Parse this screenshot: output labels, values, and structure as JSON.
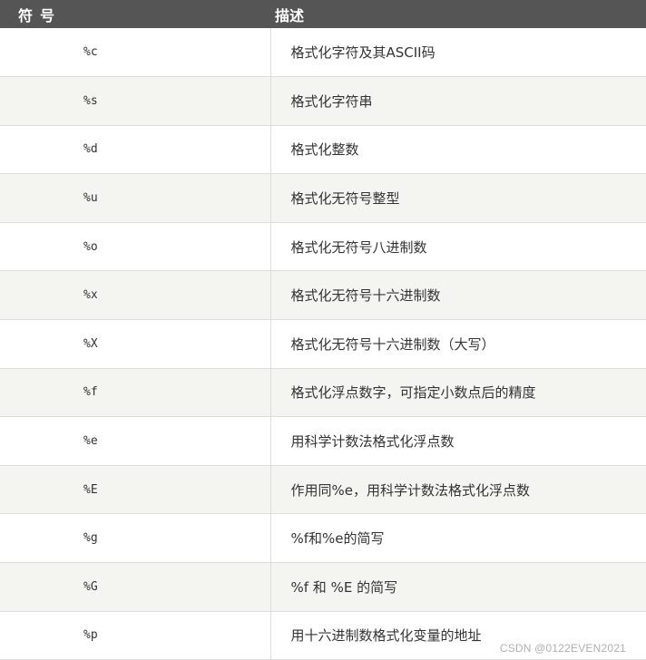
{
  "header": {
    "symbol": "符号",
    "description": "描述"
  },
  "rows": [
    {
      "symbol": "%c",
      "description": "格式化字符及其ASCII码"
    },
    {
      "symbol": "%s",
      "description": "格式化字符串"
    },
    {
      "symbol": "%d",
      "description": "格式化整数"
    },
    {
      "symbol": "%u",
      "description": "格式化无符号整型"
    },
    {
      "symbol": "%o",
      "description": "格式化无符号八进制数"
    },
    {
      "symbol": "%x",
      "description": "格式化无符号十六进制数"
    },
    {
      "symbol": "%X",
      "description": "格式化无符号十六进制数（大写）"
    },
    {
      "symbol": "%f",
      "description": "格式化浮点数字，可指定小数点后的精度"
    },
    {
      "symbol": "%e",
      "description": "用科学计数法格式化浮点数"
    },
    {
      "symbol": "%E",
      "description": "作用同%e，用科学计数法格式化浮点数"
    },
    {
      "symbol": "%g",
      "description": "%f和%e的简写"
    },
    {
      "symbol": "%G",
      "description": "%f 和 %E 的简写"
    },
    {
      "symbol": "%p",
      "description": "用十六进制数格式化变量的地址"
    }
  ],
  "watermark": "CSDN @0122EVEN2021"
}
